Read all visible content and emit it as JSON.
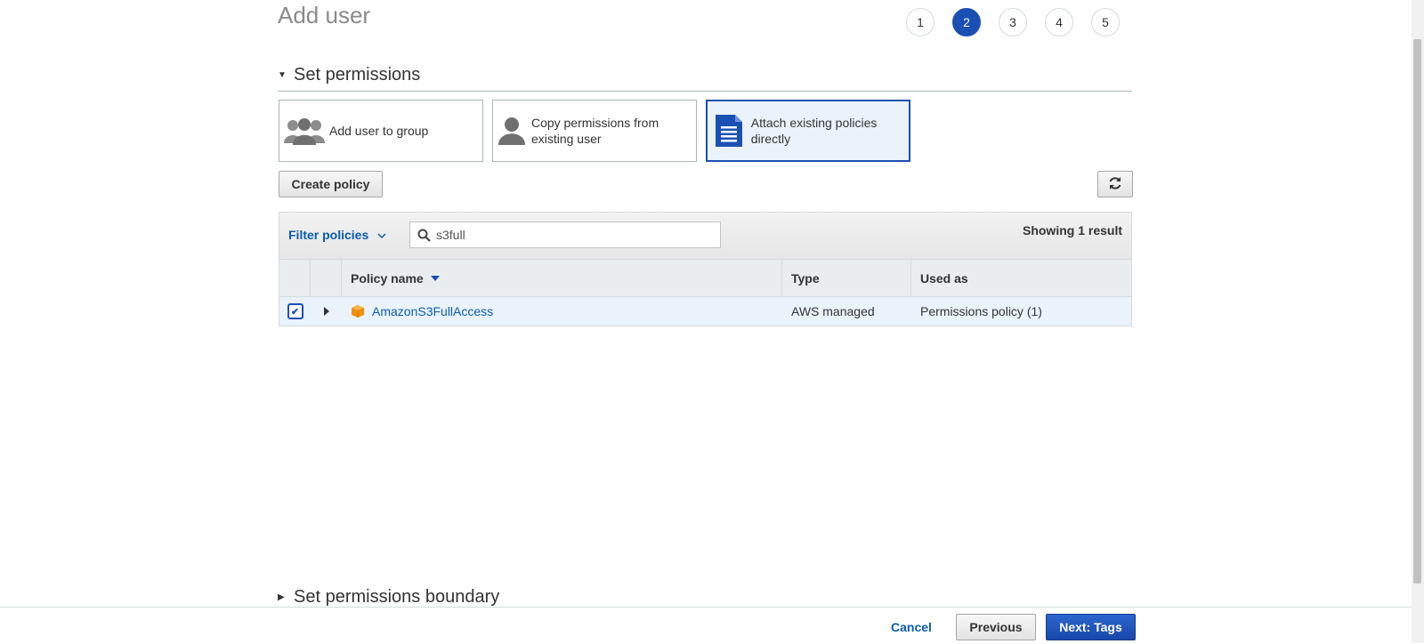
{
  "header": {
    "title": "Add user"
  },
  "steps": [
    "1",
    "2",
    "3",
    "4",
    "5"
  ],
  "active_step": "2",
  "permissions": {
    "section_title": "Set permissions",
    "options": [
      {
        "label": "Add user to group",
        "icon": "users-group-icon",
        "selected": false
      },
      {
        "label": "Copy permissions from existing user",
        "icon": "user-icon",
        "selected": false
      },
      {
        "label": "Attach existing policies directly",
        "icon": "document-icon",
        "selected": true
      }
    ],
    "create_policy_label": "Create policy",
    "refresh_icon": "refresh-icon"
  },
  "filter": {
    "label": "Filter policies",
    "search_value": "s3full",
    "result_count": "Showing 1 result"
  },
  "table": {
    "columns": [
      "Policy name",
      "Type",
      "Used as"
    ],
    "rows": [
      {
        "checked": true,
        "name": "AmazonS3FullAccess",
        "type": "AWS managed",
        "used_as": "Permissions policy (1)",
        "icon": "policy-box-icon"
      }
    ]
  },
  "boundary": {
    "section_title": "Set permissions boundary"
  },
  "footer": {
    "cancel_label": "Cancel",
    "previous_label": "Previous",
    "next_label": "Next: Tags"
  },
  "colors": {
    "accent": "#1a4fb4",
    "link": "#0b5cad",
    "selected_bg": "#eaf3fc"
  }
}
